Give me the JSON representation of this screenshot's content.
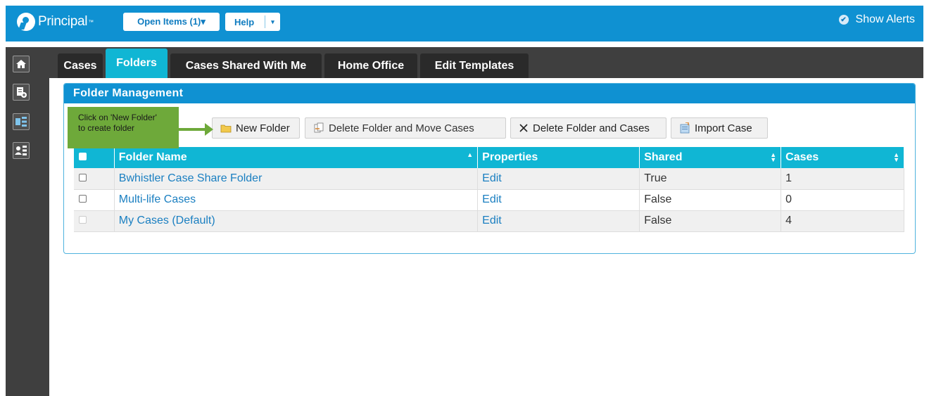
{
  "header": {
    "brand": "Principal",
    "open_items_label": "Open Items (1)▾",
    "help_label": "Help",
    "help_caret": "▾",
    "alerts_label": "Show Alerts"
  },
  "tabs": [
    {
      "label": "Cases",
      "active": false
    },
    {
      "label": "Folders",
      "active": true
    },
    {
      "label": "Cases Shared With Me",
      "active": false
    },
    {
      "label": "Home Office",
      "active": false
    },
    {
      "label": "Edit Templates",
      "active": false
    }
  ],
  "panel": {
    "title": "Folder Management"
  },
  "callout": {
    "line1": "Click on 'New Folder'",
    "line2": "to create folder"
  },
  "toolbar": {
    "new_folder": "New Folder",
    "delete_move": "Delete Folder and Move Cases",
    "delete_cases": "Delete Folder and Cases",
    "import_case": "Import Case"
  },
  "table": {
    "columns": [
      "Folder Name",
      "Properties",
      "Shared",
      "Cases"
    ],
    "rows": [
      {
        "name": "Bwhistler Case Share Folder",
        "properties": "Edit",
        "shared": "True",
        "cases": "1",
        "checkbox_enabled": true
      },
      {
        "name": "Multi-life Cases",
        "properties": "Edit",
        "shared": "False",
        "cases": "0",
        "checkbox_enabled": true
      },
      {
        "name": "My Cases (Default)",
        "properties": "Edit",
        "shared": "False",
        "cases": "4",
        "checkbox_enabled": false
      }
    ]
  },
  "colors": {
    "brand_blue": "#0f91d2",
    "active_tab": "#10b6d4",
    "callout_green": "#6ea93a",
    "link": "#1a7fc1"
  }
}
